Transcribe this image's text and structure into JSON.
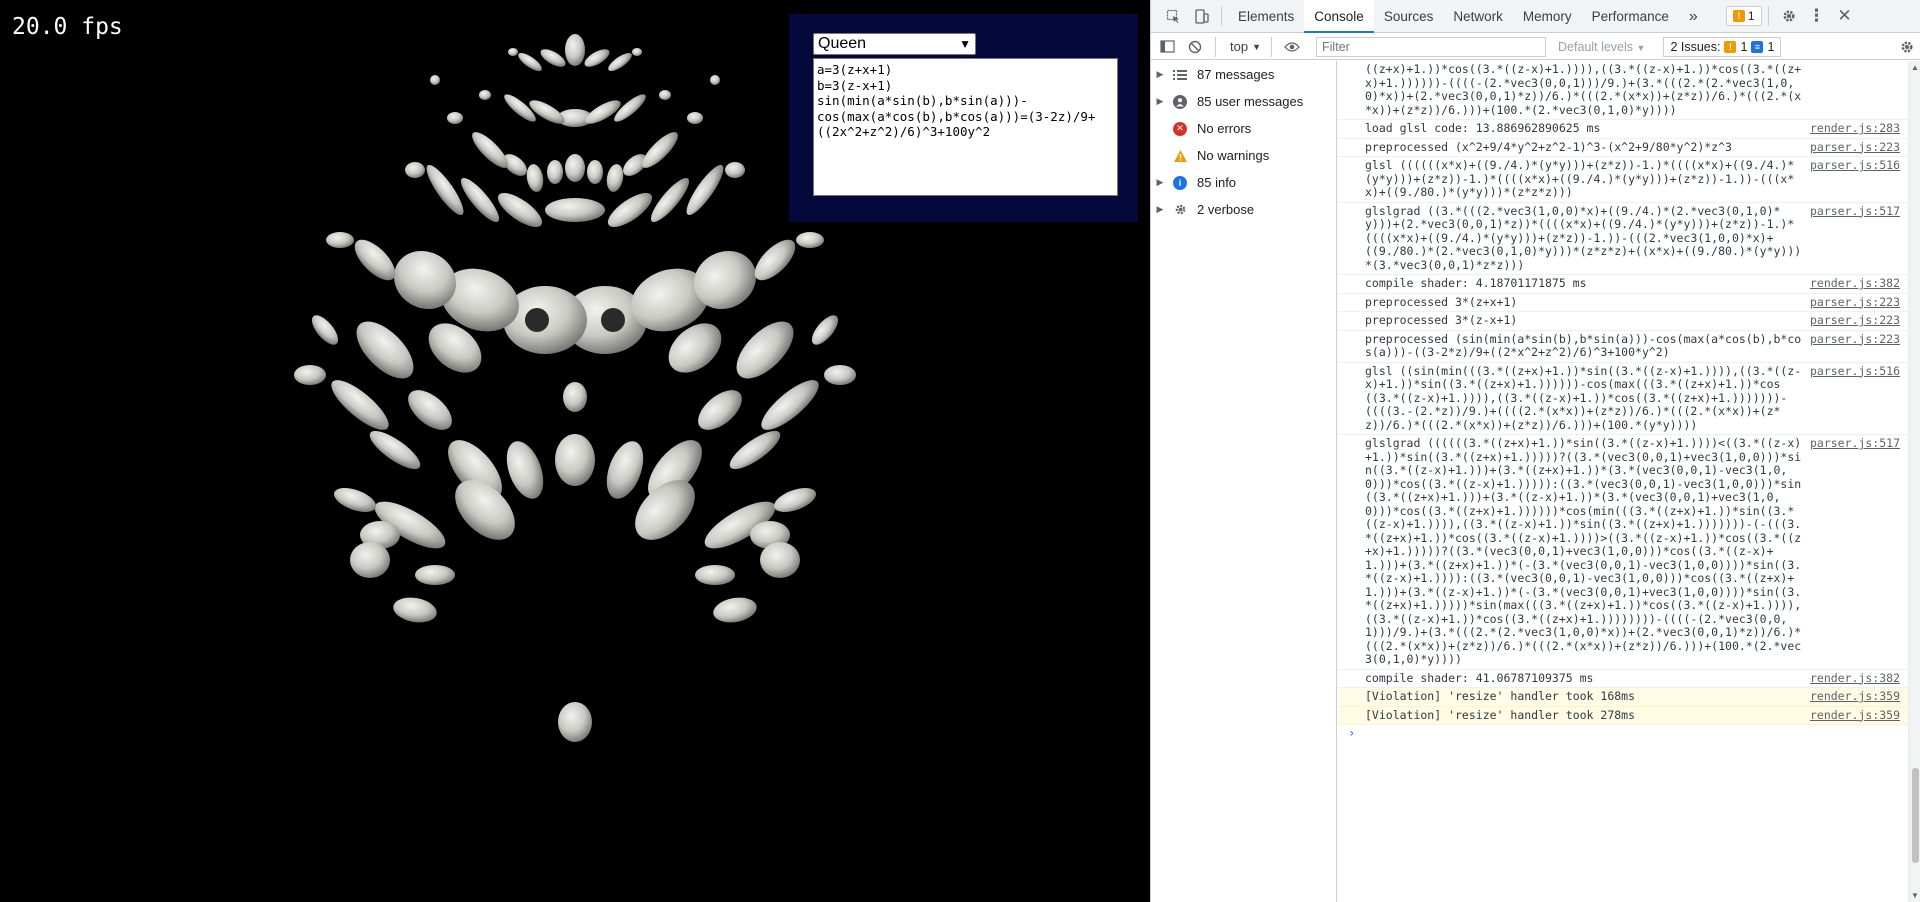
{
  "viewport": {
    "fps": "20.0 fps",
    "preset_selected": "Queen",
    "equation": "a=3(z+x+1)\nb=3(z-x+1)\nsin(min(a*sin(b),b*sin(a)))-cos(max(a*cos(b),b*cos(a)))=(3-2z)/9+((2x^2+z^2)/6)^3+100y^2"
  },
  "devtools": {
    "tabs": [
      "Elements",
      "Console",
      "Sources",
      "Network",
      "Memory",
      "Performance"
    ],
    "active_tab": "Console",
    "more_tabs": "»",
    "warning_count": "1",
    "context": "top",
    "filter_placeholder": "Filter",
    "levels": "Default levels",
    "issues_label": "2 Issues:",
    "issues_warn": "1",
    "issues_info": "1",
    "sidebar": [
      {
        "label": "87 messages",
        "icon": "list-icon",
        "expandable": true
      },
      {
        "label": "85 user messages",
        "icon": "user-icon",
        "expandable": true
      },
      {
        "label": "No errors",
        "icon": "error-icon",
        "expandable": false
      },
      {
        "label": "No warnings",
        "icon": "warning-icon",
        "expandable": false
      },
      {
        "label": "85 info",
        "icon": "info-icon",
        "expandable": true
      },
      {
        "label": "2 verbose",
        "icon": "verbose-icon",
        "expandable": true
      }
    ],
    "messages": [
      {
        "text": "((z+x)+1.))*cos((3.*((z-x)+1.)))),((3.*((z-x)+1.))*cos((3.*((z+x)+1.))))))-((((-(2.*vec3(0,0,1)))/9.)+(3.*(((2.*(2.*vec3(1,0,0)*x))+(2.*vec3(0,0,1)*z))/6.)*(((2.*(x*x))+(z*z))/6.)*(((2.*(x*x))+(z*z))/6.)))+(100.*(2.*vec3(0,1,0)*y))))",
        "src": "",
        "violation": false
      },
      {
        "text": "load glsl code: 13.886962890625 ms",
        "src": "render.js:283",
        "violation": false
      },
      {
        "text": "preprocessed (x^2+9/4*y^2+z^2-1)^3-(x^2+9/80*y^2)*z^3",
        "src": "parser.js:223",
        "violation": false
      },
      {
        "text": "glsl ((((((x*x)+((9./4.)*(y*y)))+(z*z))-1.)*((((x*x)+((9./4.)*(y*y)))+(z*z))-1.)*((((x*x)+((9./4.)*(y*y)))+(z*z))-1.))-(((x*x)+((9./80.)*(y*y)))*(z*z*z)))",
        "src": "parser.js:516",
        "violation": false
      },
      {
        "text": "glslgrad ((3.*(((2.*vec3(1,0,0)*x)+((9./4.)*(2.*vec3(0,1,0)*y)))+(2.*vec3(0,0,1)*z))*((((x*x)+((9./4.)*(y*y)))+(z*z))-1.)*((((x*x)+((9./4.)*(y*y)))+(z*z))-1.))-(((2.*vec3(1,0,0)*x)+((9./80.)*(2.*vec3(0,1,0)*y)))*(z*z*z)+((x*x)+((9./80.)*(y*y)))*(3.*vec3(0,0,1)*z*z)))",
        "src": "parser.js:517",
        "violation": false
      },
      {
        "text": "compile shader: 4.18701171875 ms",
        "src": "render.js:382",
        "violation": false
      },
      {
        "text": "preprocessed 3*(z+x+1)",
        "src": "parser.js:223",
        "violation": false
      },
      {
        "text": "preprocessed 3*(z-x+1)",
        "src": "parser.js:223",
        "violation": false
      },
      {
        "text": "preprocessed (sin(min(a*sin(b),b*sin(a)))-cos(max(a*cos(b),b*cos(a)))-((3-2*z)/9+((2*x^2+z^2)/6)^3+100*y^2)",
        "src": "parser.js:223",
        "violation": false
      },
      {
        "text": "glsl ((sin(min(((3.*((z+x)+1.))*sin((3.*((z-x)+1.)))),((3.*((z-x)+1.))*sin((3.*((z+x)+1.))))))-cos(max(((3.*((z+x)+1.))*cos((3.*((z-x)+1.)))),((3.*((z-x)+1.))*cos((3.*((z+x)+1.)))))))-((((3.-(2.*z))/9.)+((((2.*(x*x))+(z*z))/6.)*(((2.*(x*x))+(z*z))/6.)*(((2.*(x*x))+(z*z))/6.)))+(100.*(y*y))))",
        "src": "parser.js:516",
        "violation": false
      },
      {
        "text": "glslgrad ((((((3.*((z+x)+1.))*sin((3.*((z-x)+1.))))<((3.*((z-x)+1.))*sin((3.*((z+x)+1.)))))?((3.*(vec3(0,0,1)+vec3(1,0,0)))*sin((3.*((z-x)+1.)))+(3.*((z+x)+1.))*(3.*(vec3(0,0,1)-vec3(1,0,0)))*cos((3.*((z-x)+1.))))):((3.*(vec3(0,0,1)-vec3(1,0,0)))*sin((3.*((z+x)+1.)))+(3.*((z-x)+1.))*(3.*(vec3(0,0,1)+vec3(1,0,0)))*cos((3.*((z+x)+1.))))))*cos(min(((3.*((z+x)+1.))*sin((3.*((z-x)+1.)))),((3.*((z-x)+1.))*sin((3.*((z+x)+1.)))))))-(-(((3.*((z+x)+1.))*cos((3.*((z-x)+1.))))>((3.*((z-x)+1.))*cos((3.*((z+x)+1.)))))?((3.*(vec3(0,0,1)+vec3(1,0,0)))*cos((3.*((z-x)+1.)))+(3.*((z+x)+1.))*(-(3.*(vec3(0,0,1)-vec3(1,0,0))))*sin((3.*((z-x)+1.)))):((3.*(vec3(0,0,1)-vec3(1,0,0)))*cos((3.*((z+x)+1.)))+(3.*((z-x)+1.))*(-(3.*(vec3(0,0,1)+vec3(1,0,0))))*sin((3.*((z+x)+1.)))))*sin(max(((3.*((z+x)+1.))*cos((3.*((z-x)+1.)))),((3.*((z-x)+1.))*cos((3.*((z+x)+1.))))))))-((((-(2.*vec3(0,0,1)))/9.)+(3.*(((2.*(2.*vec3(1,0,0)*x))+(2.*vec3(0,0,1)*z))/6.)*(((2.*(x*x))+(z*z))/6.)*(((2.*(x*x))+(z*z))/6.)))+(100.*(2.*vec3(0,1,0)*y))))",
        "src": "parser.js:517",
        "violation": false
      },
      {
        "text": "compile shader: 41.06787109375 ms",
        "src": "render.js:382",
        "violation": false
      },
      {
        "text": "[Violation] 'resize' handler took 168ms",
        "src": "render.js:359",
        "violation": true
      },
      {
        "text": "[Violation] 'resize' handler took 278ms",
        "src": "render.js:359",
        "violation": true
      }
    ],
    "prompt": "›"
  }
}
